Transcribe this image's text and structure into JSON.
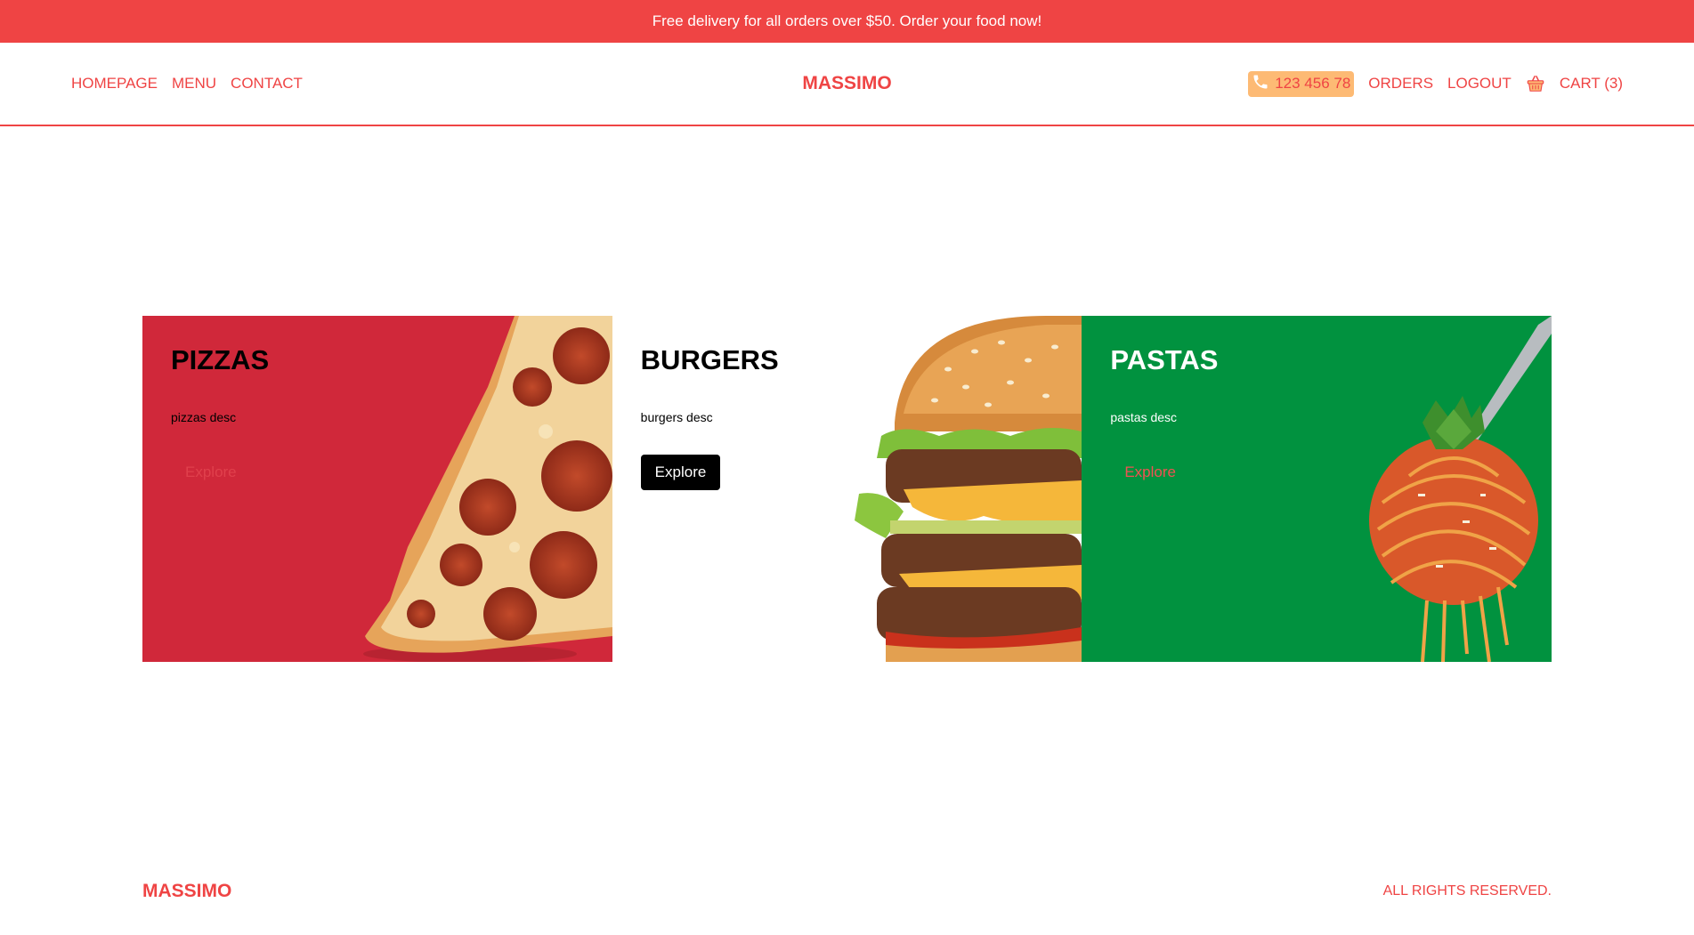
{
  "announcement": "Free delivery for all orders over $50. Order your food now!",
  "nav": {
    "links": [
      "HOMEPAGE",
      "MENU",
      "CONTACT"
    ],
    "brand": "MASSIMO",
    "phone": "123 456 78",
    "orders": "ORDERS",
    "logout": "LOGOUT",
    "cart": "CART (3)"
  },
  "cards": [
    {
      "title": "PIZZAS",
      "desc": "pizzas desc",
      "button": "Explore",
      "bg": "#d0283a"
    },
    {
      "title": "BURGERS",
      "desc": "burgers desc",
      "button": "Explore",
      "bg": "#ffffff"
    },
    {
      "title": "PASTAS",
      "desc": "pastas desc",
      "button": "Explore",
      "bg": "#01923f"
    }
  ],
  "footer": {
    "brand": "MASSIMO",
    "rights": "ALL RIGHTS RESERVED."
  },
  "icons": {
    "phone": "phone-icon",
    "cart": "shopping-basket-icon"
  },
  "colors": {
    "accent": "#ef4444",
    "phone_bg": "#fdba74"
  }
}
